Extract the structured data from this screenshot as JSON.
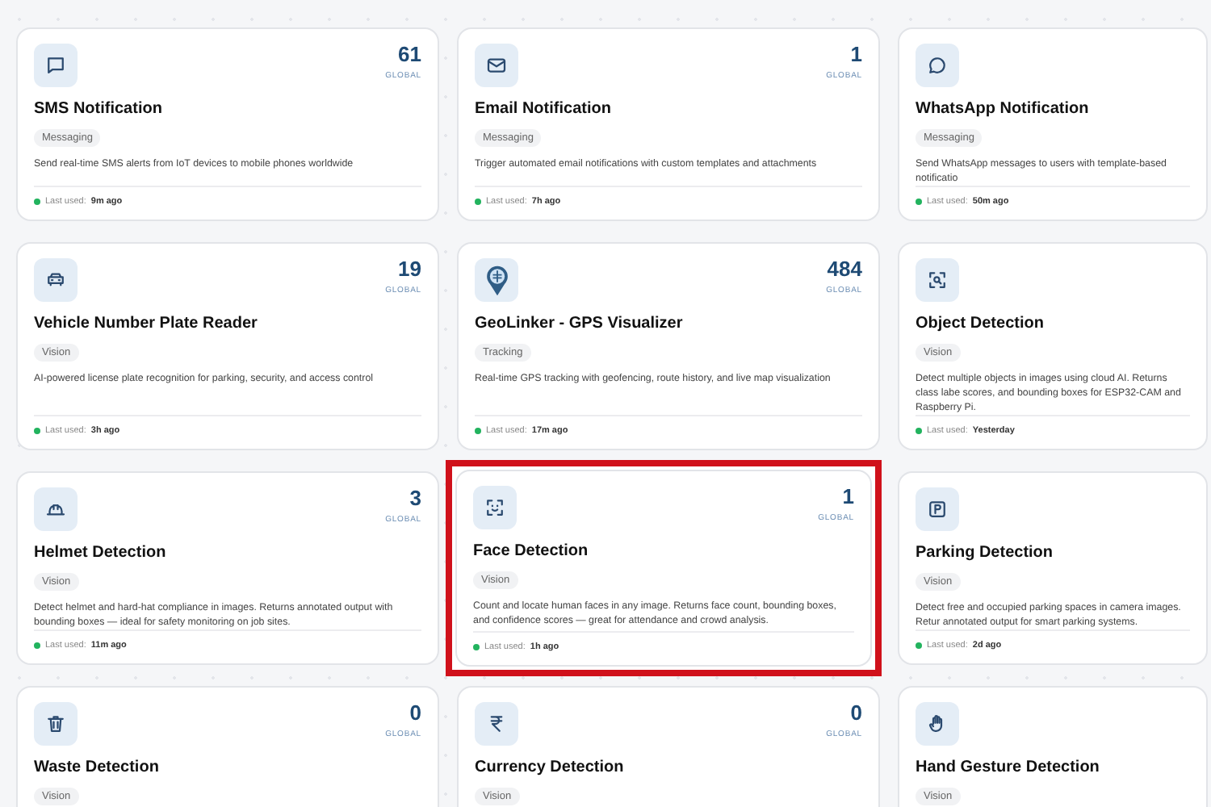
{
  "cards": [
    {
      "kind": "chat",
      "count": "61",
      "count_label": "GLOBAL",
      "title": "SMS Notification",
      "tag": "Messaging",
      "description": "Send real-time SMS alerts from IoT devices to mobile phones worldwide",
      "last_used_label": "Last used:",
      "last_used": "9m ago",
      "highlighted": false
    },
    {
      "kind": "mail",
      "count": "1",
      "count_label": "GLOBAL",
      "title": "Email Notification",
      "tag": "Messaging",
      "description": "Trigger automated email notifications with custom templates and attachments",
      "last_used_label": "Last used:",
      "last_used": "7h ago",
      "highlighted": false
    },
    {
      "kind": "bubble",
      "title": "WhatsApp Notification",
      "tag": "Messaging",
      "description": "Send WhatsApp messages to users with template-based notificatio",
      "last_used_label": "Last used:",
      "last_used": "50m ago",
      "highlighted": false
    },
    {
      "kind": "car",
      "count": "19",
      "count_label": "GLOBAL",
      "title": "Vehicle Number Plate Reader",
      "tag": "Vision",
      "description": "AI-powered license plate recognition for parking, security, and access control",
      "last_used_label": "Last used:",
      "last_used": "3h ago",
      "highlighted": false
    },
    {
      "kind": "pin",
      "count": "484",
      "count_label": "GLOBAL",
      "title": "GeoLinker - GPS Visualizer",
      "tag": "Tracking",
      "description": "Real-time GPS tracking with geofencing, route history, and live map visualization",
      "last_used_label": "Last used:",
      "last_used": "17m ago",
      "highlighted": false
    },
    {
      "kind": "scan",
      "title": "Object Detection",
      "tag": "Vision",
      "description": "Detect multiple objects in images using cloud AI. Returns class labe scores, and bounding boxes for ESP32-CAM and Raspberry Pi.",
      "last_used_label": "Last used:",
      "last_used": "Yesterday",
      "highlighted": false
    },
    {
      "kind": "helmet",
      "count": "3",
      "count_label": "GLOBAL",
      "title": "Helmet Detection",
      "tag": "Vision",
      "description": "Detect helmet and hard-hat compliance in images. Returns annotated output with bounding boxes — ideal for safety monitoring on job sites.",
      "last_used_label": "Last used:",
      "last_used": "11m ago",
      "highlighted": false
    },
    {
      "kind": "face",
      "count": "1",
      "count_label": "GLOBAL",
      "title": "Face Detection",
      "tag": "Vision",
      "description": "Count and locate human faces in any image. Returns face count, bounding boxes, and confidence scores — great for attendance and crowd analysis.",
      "last_used_label": "Last used:",
      "last_used": "1h ago",
      "highlighted": true
    },
    {
      "kind": "parking",
      "title": "Parking Detection",
      "tag": "Vision",
      "description": "Detect free and occupied parking spaces in camera images. Retur annotated output for smart parking systems.",
      "last_used_label": "Last used:",
      "last_used": "2d ago",
      "highlighted": false
    },
    {
      "kind": "trash",
      "count": "0",
      "count_label": "GLOBAL",
      "title": "Waste Detection",
      "tag": "Vision",
      "highlighted": false
    },
    {
      "kind": "rupee",
      "count": "0",
      "count_label": "GLOBAL",
      "title": "Currency Detection",
      "tag": "Vision",
      "highlighted": false
    },
    {
      "kind": "hand",
      "title": "Hand Gesture Detection",
      "tag": "Vision",
      "highlighted": false
    }
  ]
}
